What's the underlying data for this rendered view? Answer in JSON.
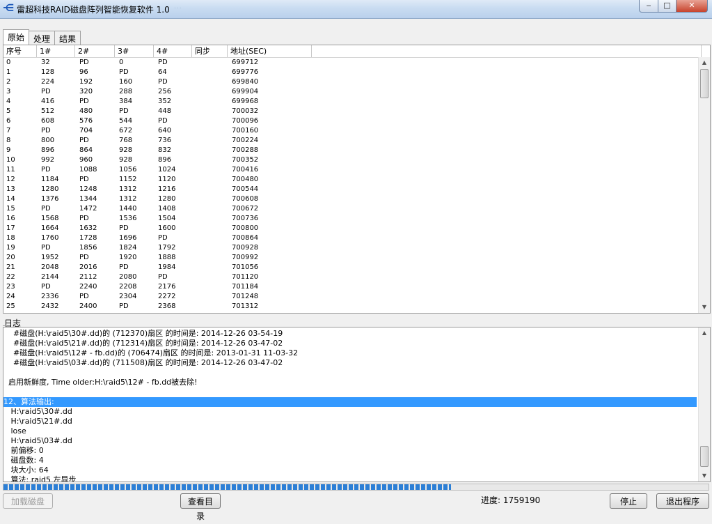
{
  "window": {
    "title": "雷超科技RAID磁盘阵列智能恢复软件 1.0",
    "app_icon": "app-logo-icon",
    "ghost_title": "...",
    "buttons": {
      "minimize": "‒",
      "maximize": "□",
      "close": "✕"
    }
  },
  "tabs": [
    {
      "label": "原始",
      "active": true
    },
    {
      "label": "处理",
      "active": false
    },
    {
      "label": "结果",
      "active": false
    }
  ],
  "table": {
    "columns": [
      "序号",
      "1#",
      "2#",
      "3#",
      "4#",
      "同步",
      "地址(SEC)",
      ""
    ],
    "rows": [
      [
        "0",
        "32",
        "PD",
        "0",
        "PD",
        "",
        "699712"
      ],
      [
        "1",
        "128",
        "96",
        "PD",
        "64",
        "",
        "699776"
      ],
      [
        "2",
        "224",
        "192",
        "160",
        "PD",
        "",
        "699840"
      ],
      [
        "3",
        "PD",
        "320",
        "288",
        "256",
        "",
        "699904"
      ],
      [
        "4",
        "416",
        "PD",
        "384",
        "352",
        "",
        "699968"
      ],
      [
        "5",
        "512",
        "480",
        "PD",
        "448",
        "",
        "700032"
      ],
      [
        "6",
        "608",
        "576",
        "544",
        "PD",
        "",
        "700096"
      ],
      [
        "7",
        "PD",
        "704",
        "672",
        "640",
        "",
        "700160"
      ],
      [
        "8",
        "800",
        "PD",
        "768",
        "736",
        "",
        "700224"
      ],
      [
        "9",
        "896",
        "864",
        "928",
        "832",
        "",
        "700288"
      ],
      [
        "10",
        "992",
        "960",
        "928",
        "896",
        "",
        "700352"
      ],
      [
        "11",
        "PD",
        "1088",
        "1056",
        "1024",
        "",
        "700416"
      ],
      [
        "12",
        "1184",
        "PD",
        "1152",
        "1120",
        "",
        "700480"
      ],
      [
        "13",
        "1280",
        "1248",
        "1312",
        "1216",
        "",
        "700544"
      ],
      [
        "14",
        "1376",
        "1344",
        "1312",
        "1280",
        "",
        "700608"
      ],
      [
        "15",
        "PD",
        "1472",
        "1440",
        "1408",
        "",
        "700672"
      ],
      [
        "16",
        "1568",
        "PD",
        "1536",
        "1504",
        "",
        "700736"
      ],
      [
        "17",
        "1664",
        "1632",
        "PD",
        "1600",
        "",
        "700800"
      ],
      [
        "18",
        "1760",
        "1728",
        "1696",
        "PD",
        "",
        "700864"
      ],
      [
        "19",
        "PD",
        "1856",
        "1824",
        "1792",
        "",
        "700928"
      ],
      [
        "20",
        "1952",
        "PD",
        "1920",
        "1888",
        "",
        "700992"
      ],
      [
        "21",
        "2048",
        "2016",
        "PD",
        "1984",
        "",
        "701056"
      ],
      [
        "22",
        "2144",
        "2112",
        "2080",
        "PD",
        "",
        "701120"
      ],
      [
        "23",
        "PD",
        "2240",
        "2208",
        "2176",
        "",
        "701184"
      ],
      [
        "24",
        "2336",
        "PD",
        "2304",
        "2272",
        "",
        "701248"
      ],
      [
        "25",
        "2432",
        "2400",
        "PD",
        "2368",
        "",
        "701312"
      ]
    ]
  },
  "log": {
    "label": "日志",
    "lines": [
      {
        "text": "    #磁盘(H:\\raid5\\30#.dd)的 (712370)扇区 的时间是: 2014-12-26 03-54-19",
        "selected": false
      },
      {
        "text": "    #磁盘(H:\\raid5\\21#.dd)的 (712314)扇区 的时间是: 2014-12-26 03-47-02",
        "selected": false
      },
      {
        "text": "    #磁盘(H:\\raid5\\12# - fb.dd)的 (706474)扇区 的时间是: 2013-01-31 11-03-32",
        "selected": false
      },
      {
        "text": "    #磁盘(H:\\raid5\\03#.dd)的 (711508)扇区 的时间是: 2014-12-26 03-47-02",
        "selected": false
      },
      {
        "text": "",
        "selected": false
      },
      {
        "text": "  启用新鲜度, Time older:H:\\raid5\\12# - fb.dd被去除!",
        "selected": false
      },
      {
        "text": "",
        "selected": false
      },
      {
        "text": "12、算法输出:",
        "selected": true
      },
      {
        "text": "   H:\\raid5\\30#.dd",
        "selected": false
      },
      {
        "text": "   H:\\raid5\\21#.dd",
        "selected": false
      },
      {
        "text": "   lose",
        "selected": false
      },
      {
        "text": "   H:\\raid5\\03#.dd",
        "selected": false
      },
      {
        "text": "   前偏移: 0",
        "selected": false
      },
      {
        "text": "   磁盘数: 4",
        "selected": false
      },
      {
        "text": "   块大小: 64",
        "selected": false
      },
      {
        "text": "   算法: raid5 左异步",
        "selected": false
      }
    ]
  },
  "progress": {
    "fraction": 0.635,
    "label": "进度: 1759190"
  },
  "buttons": {
    "load_disk": "加载磁盘",
    "view_dir": "查看目录",
    "stop": "停止",
    "exit": "退出程序"
  }
}
